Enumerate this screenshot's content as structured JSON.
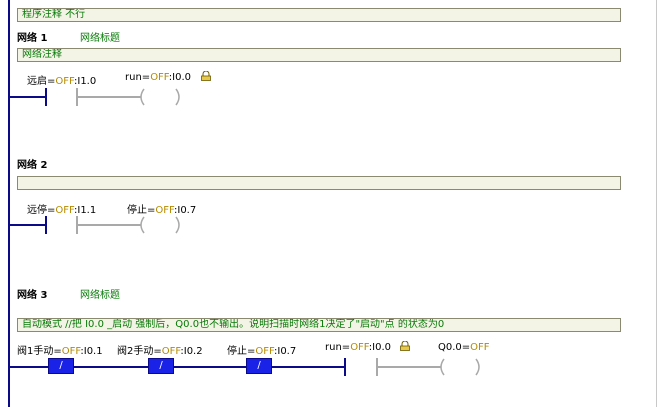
{
  "program_comment": "程序注释 不行",
  "networks": [
    {
      "title": "网络 1",
      "subtitle": "网络标题",
      "comment": "网络注释",
      "contacts": [
        {
          "sym": "远启",
          "state": "OFF",
          "addr": ":I1.0"
        },
        {
          "sym": "run",
          "state": "OFF",
          "addr": ":I0.0"
        }
      ]
    },
    {
      "title": "网络 2",
      "subtitle": "",
      "comment": "",
      "contacts": [
        {
          "sym": "远停",
          "state": "OFF",
          "addr": ":I1.1"
        },
        {
          "sym": "停止",
          "state": "OFF",
          "addr": ":I0.7"
        }
      ]
    },
    {
      "title": "网络 3",
      "subtitle": "网络标题",
      "comment": "自动模式   //把  I0.0  _启动  强制后，Q0.0也不输出。说明扫描时网络1决定了\"启动\"点  的状态为0",
      "contacts": [
        {
          "sym": "阀1手动",
          "state": "OFF",
          "addr": ":I0.1"
        },
        {
          "sym": "阀2手动",
          "state": "OFF",
          "addr": ":I0.2"
        },
        {
          "sym": "停止",
          "state": "OFF",
          "addr": ":I0.7"
        },
        {
          "sym": "run",
          "state": "OFF",
          "addr": ":I0.0"
        },
        {
          "sym": "Q0.0",
          "state": "OFF",
          "addr": ""
        }
      ],
      "nc_glyph": "/"
    }
  ],
  "colors": {
    "rail": "#0b0b8a",
    "active_contact": "#1a22e8",
    "comment_text": "#067a06",
    "state_text": "#b58a00",
    "inactive_wire": "#a9a9a9"
  },
  "icons": {
    "force_lock": "lock-icon"
  }
}
